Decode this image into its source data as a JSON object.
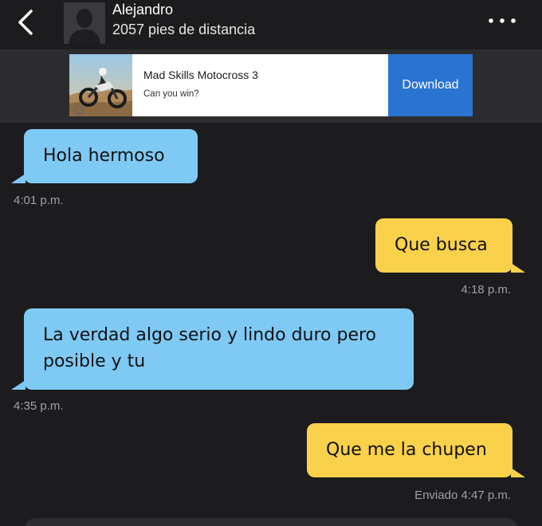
{
  "header": {
    "contact_name": "Alejandro",
    "distance": "2057 pies de distancia",
    "back_icon": "chevron-left-icon",
    "more_icon": "ellipsis-icon"
  },
  "ad": {
    "title": "Mad Skills Motocross 3",
    "subtitle": "Can you win?",
    "button_label": "Download",
    "button_color": "#2a73d1"
  },
  "messages": [
    {
      "direction": "incoming",
      "text": "Hola hermoso",
      "time": "4:01 p.m."
    },
    {
      "direction": "outgoing",
      "text": "Que busca",
      "time": "4:18 p.m."
    },
    {
      "direction": "incoming",
      "text": "La verdad algo serio y lindo duro pero posible y tu",
      "time": "4:35 p.m."
    },
    {
      "direction": "outgoing",
      "text": "Que me la chupen",
      "time": "Enviado 4:47 p.m."
    }
  ],
  "colors": {
    "background": "#1c1c1e",
    "incoming_bubble": "#7fc9f5",
    "outgoing_bubble": "#f9d14a",
    "timestamp": "#a0a0a5"
  }
}
